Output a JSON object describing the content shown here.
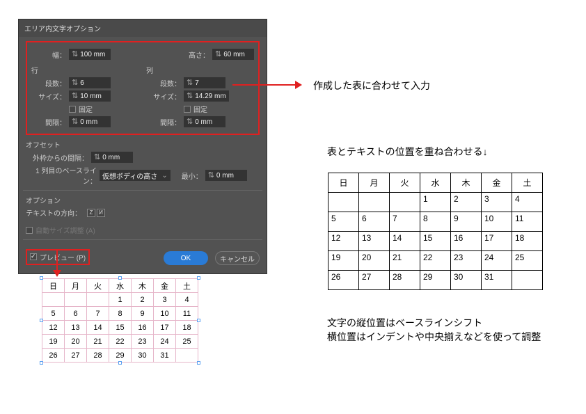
{
  "dialog": {
    "title": "エリア内文字オプション",
    "width_label": "幅：",
    "width_value": "100 mm",
    "height_label": "高さ：",
    "height_value": "60 mm",
    "rows_section": "行",
    "cols_section": "列",
    "rows_count_label": "段数：",
    "rows_count_value": "6",
    "cols_count_label": "段数：",
    "cols_count_value": "7",
    "rows_size_label": "サイズ：",
    "rows_size_value": "10 mm",
    "cols_size_label": "サイズ：",
    "cols_size_value": "14.29 mm",
    "fixed_label": "固定",
    "rows_gap_label": "間隔：",
    "rows_gap_value": "0 mm",
    "cols_gap_label": "間隔：",
    "cols_gap_value": "0 mm",
    "offset_section": "オフセット",
    "outer_margin_label": "外枠からの間隔：",
    "outer_margin_value": "0 mm",
    "baseline_label": "1 列目のベースライン：",
    "baseline_value": "仮想ボディの高さ",
    "baseline_min_label": "最小：",
    "baseline_min_value": "0 mm",
    "options_section": "オプション",
    "textdir_label": "テキストの方向：",
    "autosize_label": "自動サイズ調整 (A)",
    "preview_label": "プレビュー (P)",
    "ok_label": "OK",
    "cancel_label": "キャンセル"
  },
  "annotations": {
    "a1": "作成した表に合わせて入力",
    "a2": "表とテキストの位置を重ね合わせる↓",
    "a3": "文字の縦位置はベースラインシフト",
    "a4": "横位置はインデントや中央揃えなどを使って調整"
  },
  "calendar": {
    "headers": [
      "日",
      "月",
      "火",
      "水",
      "木",
      "金",
      "土"
    ],
    "cells": [
      [
        "",
        "",
        "",
        "1",
        "2",
        "3",
        "4"
      ],
      [
        "5",
        "6",
        "7",
        "8",
        "9",
        "10",
        "11"
      ],
      [
        "12",
        "13",
        "14",
        "15",
        "16",
        "17",
        "18"
      ],
      [
        "19",
        "20",
        "21",
        "22",
        "23",
        "24",
        "25"
      ],
      [
        "26",
        "27",
        "28",
        "29",
        "30",
        "31",
        ""
      ]
    ]
  }
}
